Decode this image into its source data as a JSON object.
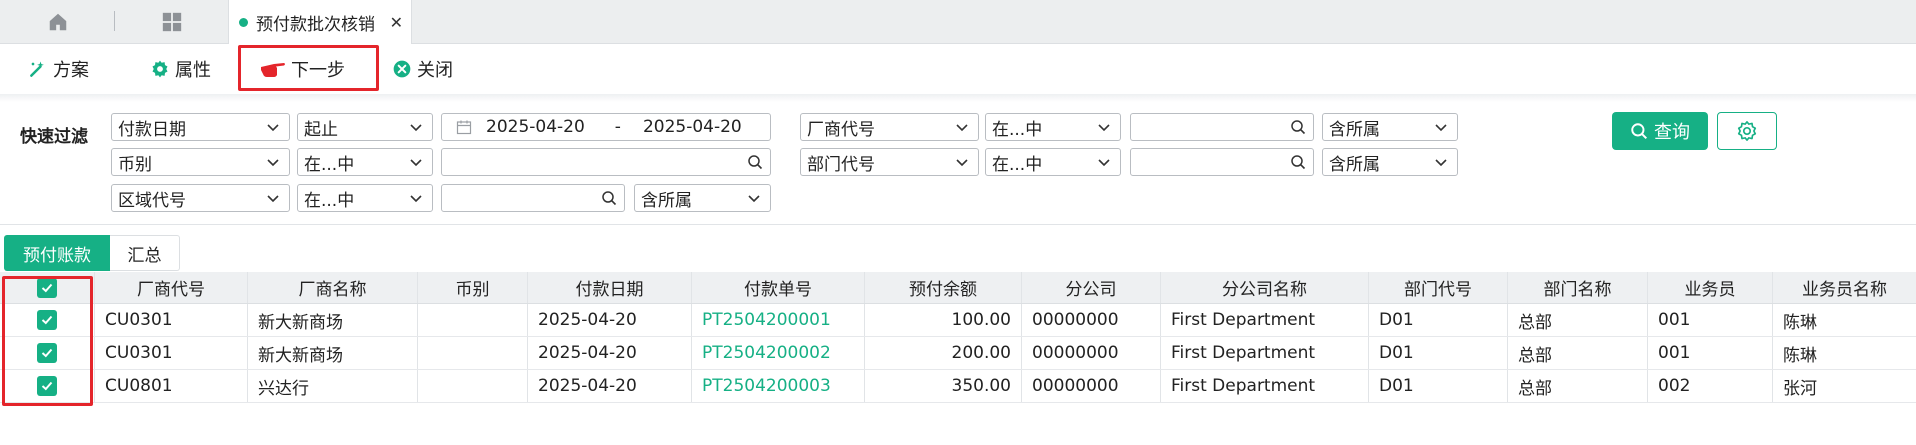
{
  "tabs": {
    "active": "预付款批次核销",
    "close_glyph": "✕"
  },
  "toolbar": {
    "scheme": "方案",
    "property": "属性",
    "next": "下一步",
    "close": "关闭"
  },
  "filter": {
    "label": "快速过滤",
    "row1": {
      "field": "付款日期",
      "op": "起止",
      "date_from": "2025-04-20",
      "date_sep": "-",
      "date_to": "2025-04-20",
      "field2": "厂商代号",
      "op2": "在...中",
      "value2": "",
      "scope2": "含所属"
    },
    "row2": {
      "field": "币别",
      "op": "在...中",
      "value": "",
      "field2": "部门代号",
      "op2": "在...中",
      "value2": "",
      "scope2": "含所属"
    },
    "row3": {
      "field": "区域代号",
      "op": "在...中",
      "value": "",
      "scope": "含所属"
    },
    "query_button": "查询"
  },
  "subtabs": [
    "预付账款",
    "汇总"
  ],
  "table": {
    "columns": [
      "厂商代号",
      "厂商名称",
      "币别",
      "付款日期",
      "付款单号",
      "预付余额",
      "分公司",
      "分公司名称",
      "部门代号",
      "部门名称",
      "业务员",
      "业务员名称"
    ],
    "rows": [
      [
        "CU0301",
        "新大新商场",
        "",
        "2025-04-20",
        "PT2504200001",
        "100.00",
        "00000000",
        "First Department",
        "D01",
        "总部",
        "001",
        "陈琳"
      ],
      [
        "CU0301",
        "新大新商场",
        "",
        "2025-04-20",
        "PT2504200002",
        "200.00",
        "00000000",
        "First Department",
        "D01",
        "总部",
        "001",
        "陈琳"
      ],
      [
        "CU0801",
        "兴达行",
        "",
        "2025-04-20",
        "PT2504200003",
        "350.00",
        "00000000",
        "First Department",
        "D01",
        "总部",
        "002",
        "张河"
      ]
    ]
  },
  "colors": {
    "accent": "#16b085",
    "highlight": "#e4252b"
  }
}
